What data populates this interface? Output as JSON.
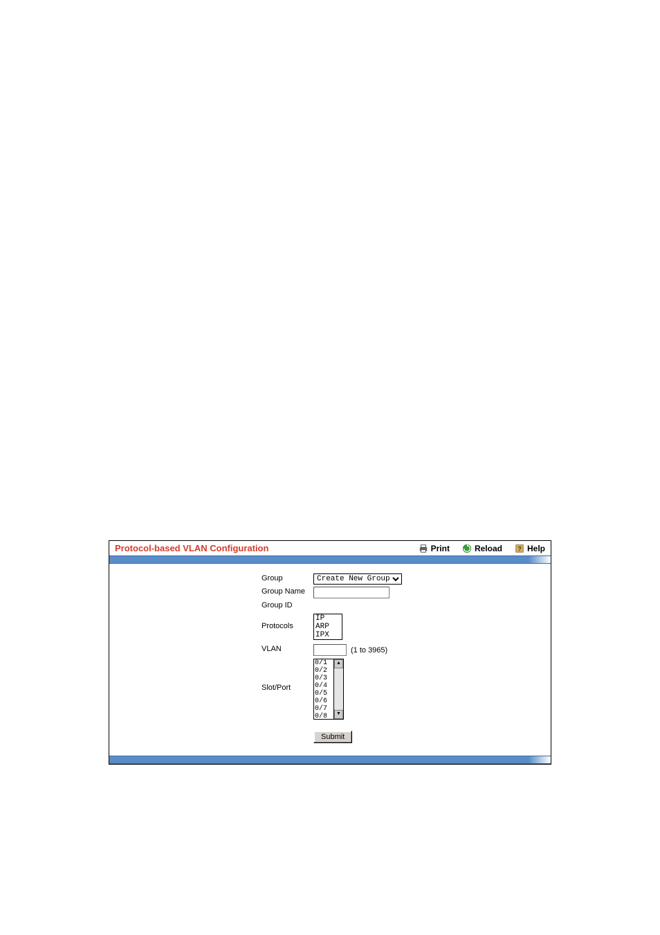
{
  "header": {
    "title": "Protocol-based VLAN Configuration",
    "print_label": "Print",
    "reload_label": "Reload",
    "help_label": "Help"
  },
  "form": {
    "group_label": "Group",
    "group_value": "Create New Group",
    "group_name_label": "Group Name",
    "group_name_value": "",
    "group_id_label": "Group ID",
    "group_id_value": "",
    "protocols_label": "Protocols",
    "protocols": [
      "IP",
      "ARP",
      "IPX"
    ],
    "vlan_label": "VLAN",
    "vlan_value": "",
    "vlan_hint": "(1 to 3965)",
    "slot_port_label": "Slot/Port",
    "slot_ports": [
      "0/1",
      "0/2",
      "0/3",
      "0/4",
      "0/5",
      "0/6",
      "0/7",
      "0/8"
    ],
    "submit_label": "Submit"
  }
}
